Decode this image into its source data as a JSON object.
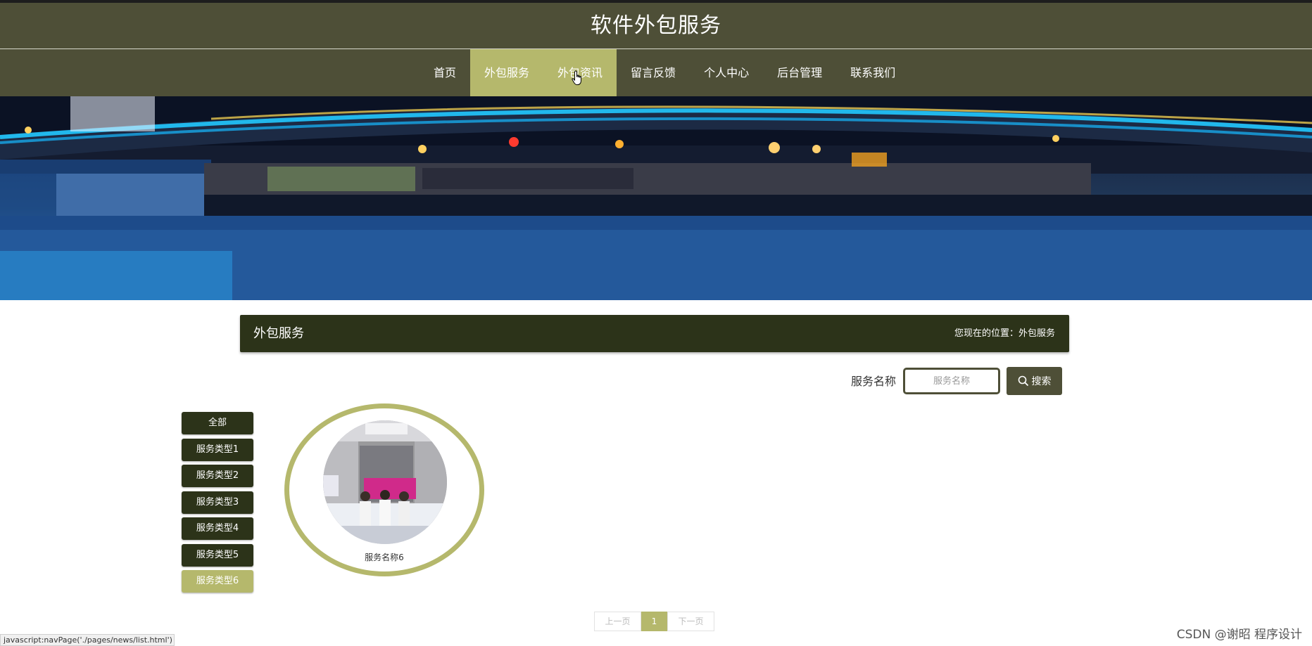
{
  "header": {
    "title": "软件外包服务"
  },
  "nav": {
    "items": [
      {
        "label": "首页",
        "active": false
      },
      {
        "label": "外包服务",
        "active": true
      },
      {
        "label": "外包资讯",
        "active": true
      },
      {
        "label": "留言反馈",
        "active": false
      },
      {
        "label": "个人中心",
        "active": false
      },
      {
        "label": "后台管理",
        "active": false
      },
      {
        "label": "联系我们",
        "active": false
      }
    ]
  },
  "banner": {
    "slides": 3,
    "active_slide": 2
  },
  "section": {
    "title": "外包服务",
    "breadcrumb_prefix": "您现在的位置：",
    "breadcrumb_current": "外包服务"
  },
  "search": {
    "label": "服务名称",
    "placeholder": "服务名称",
    "value": "",
    "button": "搜索",
    "button_icon": "search-icon"
  },
  "categories": [
    {
      "label": "全部",
      "active": false
    },
    {
      "label": "服务类型1",
      "active": false
    },
    {
      "label": "服务类型2",
      "active": false
    },
    {
      "label": "服务类型3",
      "active": false
    },
    {
      "label": "服务类型4",
      "active": false
    },
    {
      "label": "服务类型5",
      "active": false
    },
    {
      "label": "服务类型6",
      "active": true
    }
  ],
  "cards": [
    {
      "name": "服务名称6"
    }
  ],
  "pagination": {
    "prev": "上一页",
    "current": "1",
    "next": "下一页"
  },
  "status_bar": {
    "text": "javascript:navPage('./pages/news/list.html')"
  },
  "watermark": {
    "text": "CSDN @谢昭  程序设计"
  },
  "colors": {
    "primary": "#4e4f37",
    "accent": "#b5b86c",
    "dark": "#2c3319"
  }
}
